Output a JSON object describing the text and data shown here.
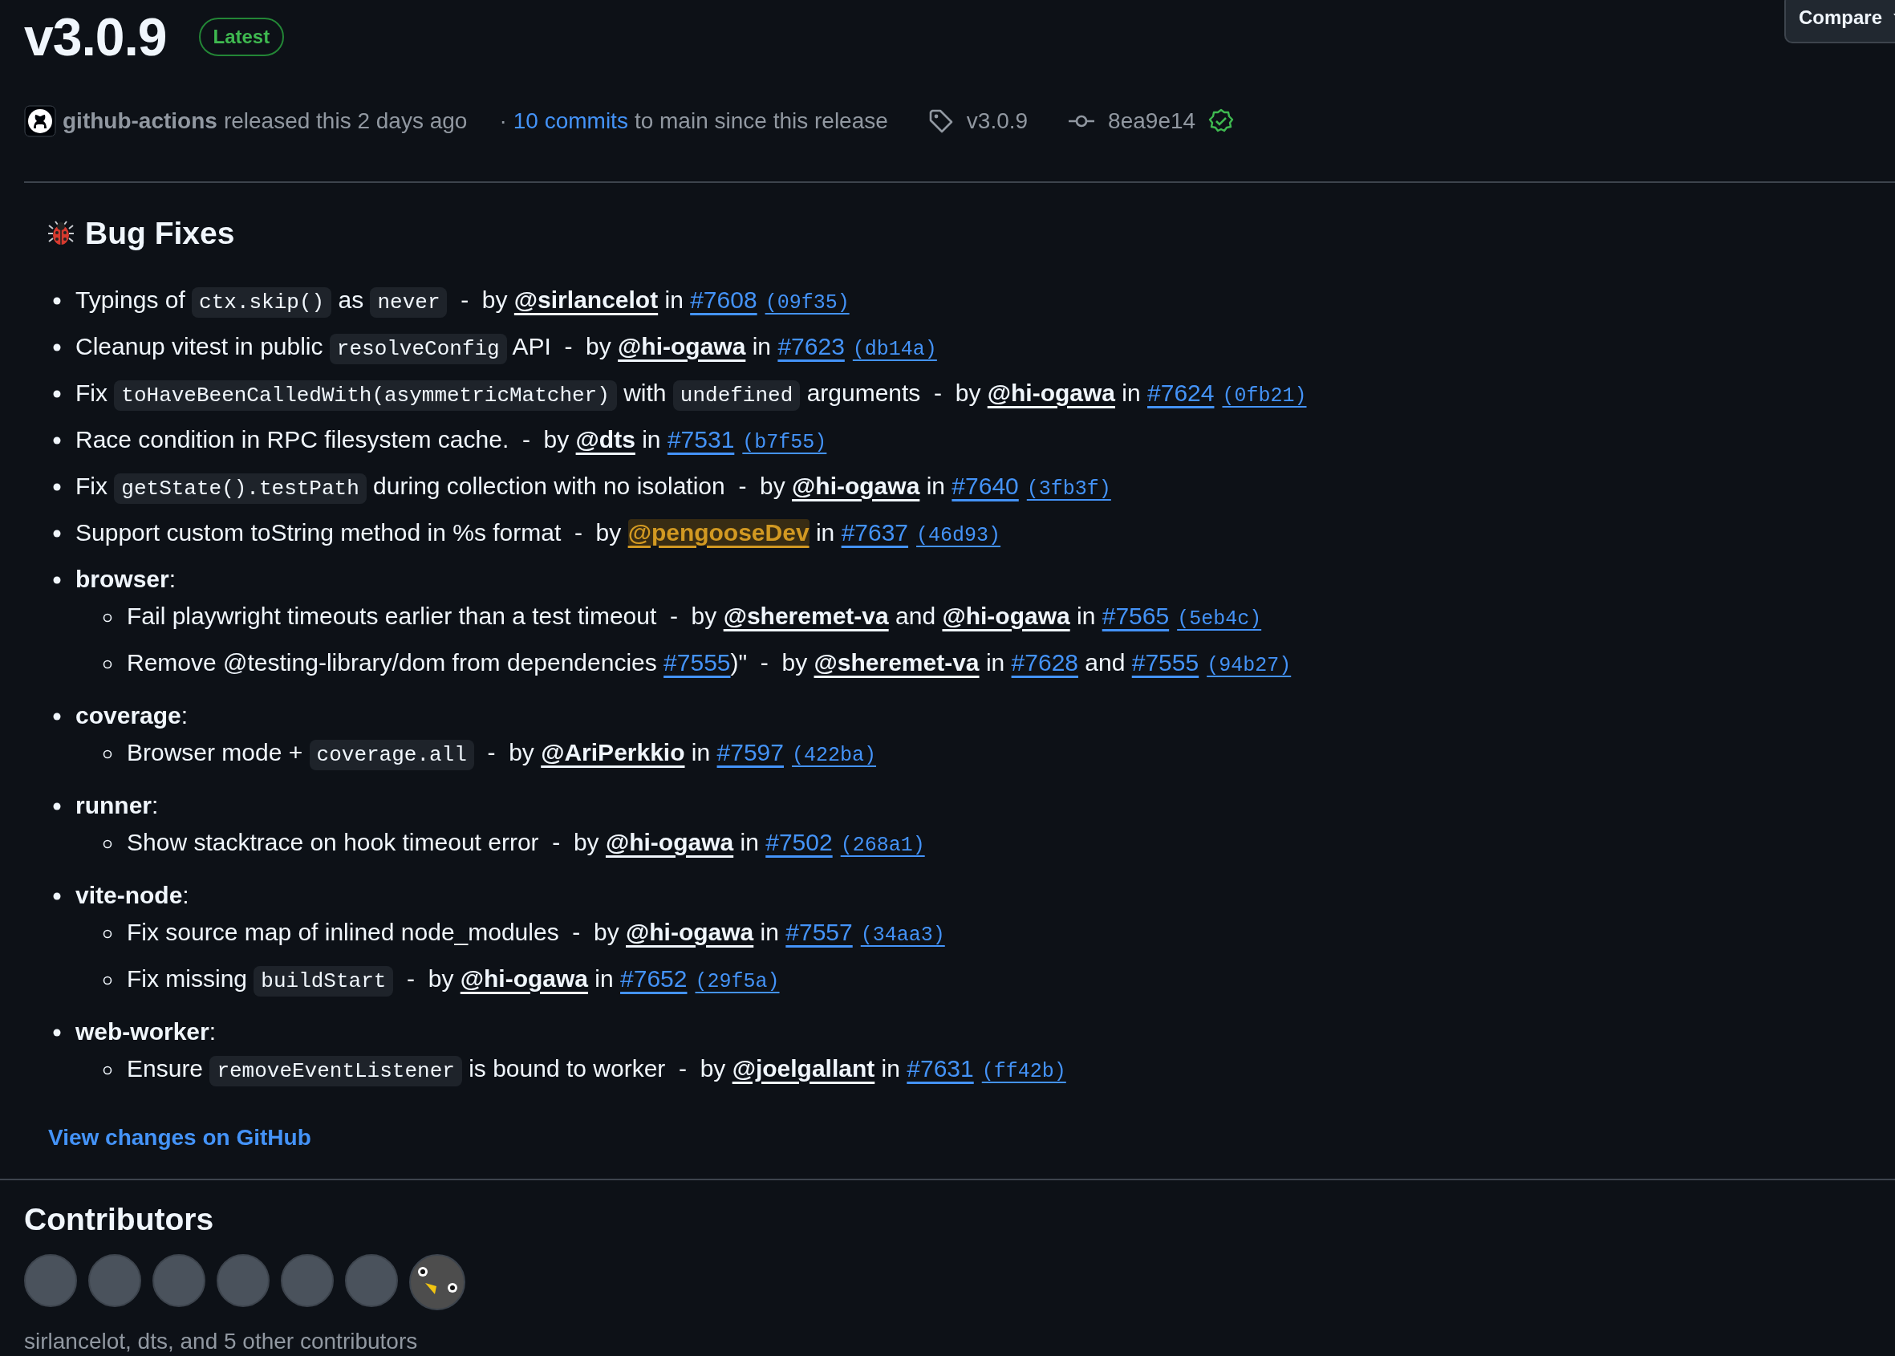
{
  "release": {
    "title": "v3.0.9",
    "badge": "Latest",
    "compare_button": "Compare",
    "author": "github-actions",
    "released_text": "released this 2 days ago",
    "separator": "·",
    "commits_link": "10 commits",
    "commits_text": "to main since this release",
    "tag": "v3.0.9",
    "commit": "8ea9e14",
    "verified": true
  },
  "bug_fixes": {
    "heading": "Bug Fixes",
    "items": [
      {
        "kind": "entry",
        "parts": [
          {
            "kind": "text",
            "text": "Typings of "
          },
          {
            "kind": "code",
            "text": "ctx.skip()"
          },
          {
            "kind": "text",
            "text": " as "
          },
          {
            "kind": "code",
            "text": "never"
          },
          {
            "kind": "text",
            "text": "  -  by "
          },
          {
            "kind": "user",
            "text": "@sirlancelot"
          },
          {
            "kind": "text",
            "text": " in "
          },
          {
            "kind": "issue",
            "text": "#7608"
          },
          {
            "kind": "hash",
            "text": "(09f35)"
          }
        ]
      },
      {
        "kind": "entry",
        "parts": [
          {
            "kind": "text",
            "text": "Cleanup vitest in public "
          },
          {
            "kind": "code",
            "text": "resolveConfig"
          },
          {
            "kind": "text",
            "text": " API  -  by "
          },
          {
            "kind": "user",
            "text": "@hi-ogawa"
          },
          {
            "kind": "text",
            "text": " in "
          },
          {
            "kind": "issue",
            "text": "#7623"
          },
          {
            "kind": "hash",
            "text": "(db14a)"
          }
        ]
      },
      {
        "kind": "entry",
        "parts": [
          {
            "kind": "text",
            "text": "Fix "
          },
          {
            "kind": "code",
            "text": "toHaveBeenCalledWith(asymmetricMatcher)"
          },
          {
            "kind": "text",
            "text": " with "
          },
          {
            "kind": "code",
            "text": "undefined"
          },
          {
            "kind": "text",
            "text": " arguments  -  by "
          },
          {
            "kind": "user",
            "text": "@hi-ogawa"
          },
          {
            "kind": "text",
            "text": " in "
          },
          {
            "kind": "issue",
            "text": "#7624"
          },
          {
            "kind": "hash",
            "text": "(0fb21)"
          }
        ]
      },
      {
        "kind": "entry",
        "parts": [
          {
            "kind": "text",
            "text": "Race condition in RPC filesystem cache.  -  by "
          },
          {
            "kind": "user",
            "text": "@dts"
          },
          {
            "kind": "text",
            "text": " in "
          },
          {
            "kind": "issue",
            "text": "#7531"
          },
          {
            "kind": "hash",
            "text": "(b7f55)"
          }
        ]
      },
      {
        "kind": "entry",
        "parts": [
          {
            "kind": "text",
            "text": "Fix "
          },
          {
            "kind": "code",
            "text": "getState().testPath"
          },
          {
            "kind": "text",
            "text": " during collection with no isolation  -  by "
          },
          {
            "kind": "user",
            "text": "@hi-ogawa"
          },
          {
            "kind": "text",
            "text": " in "
          },
          {
            "kind": "issue",
            "text": "#7640"
          },
          {
            "kind": "hash",
            "text": "(3fb3f)"
          }
        ]
      },
      {
        "kind": "entry",
        "parts": [
          {
            "kind": "text",
            "text": "Support custom toString method in %s format  -  by "
          },
          {
            "kind": "self_user",
            "text": "@pengooseDev"
          },
          {
            "kind": "text",
            "text": " in "
          },
          {
            "kind": "issue",
            "text": "#7637"
          },
          {
            "kind": "hash",
            "text": "(46d93)"
          }
        ]
      },
      {
        "kind": "group",
        "label": "**browser**:",
        "children": [
          {
            "kind": "entry",
            "parts": [
              {
                "kind": "text",
                "text": "Fail playwright timeouts earlier than a test timeout  -  by "
              },
              {
                "kind": "user",
                "text": "@sheremet-va"
              },
              {
                "kind": "text",
                "text": " and "
              },
              {
                "kind": "user",
                "text": "@hi-ogawa"
              },
              {
                "kind": "text",
                "text": " in "
              },
              {
                "kind": "issue",
                "text": "#7565"
              },
              {
                "kind": "hash",
                "text": "(5eb4c)"
              }
            ]
          },
          {
            "kind": "entry",
            "parts": [
              {
                "kind": "text",
                "text": "Remove @testing-library/dom from dependencies "
              },
              {
                "kind": "issue",
                "text": "#7555"
              },
              {
                "kind": "text",
                "text": ")\"  -  by "
              },
              {
                "kind": "user",
                "text": "@sheremet-va"
              },
              {
                "kind": "text",
                "text": " in "
              },
              {
                "kind": "issue",
                "text": "#7628"
              },
              {
                "kind": "text",
                "text": " and "
              },
              {
                "kind": "issue",
                "text": "#7555"
              },
              {
                "kind": "hash",
                "text": "(94b27)"
              }
            ]
          }
        ]
      },
      {
        "kind": "group",
        "label": "**coverage**:",
        "children": [
          {
            "kind": "entry",
            "parts": [
              {
                "kind": "text",
                "text": "Browser mode + "
              },
              {
                "kind": "code",
                "text": "coverage.all"
              },
              {
                "kind": "text",
                "text": "  -  by "
              },
              {
                "kind": "user",
                "text": "@AriPerkkio"
              },
              {
                "kind": "text",
                "text": " in "
              },
              {
                "kind": "issue",
                "text": "#7597"
              },
              {
                "kind": "hash",
                "text": "(422ba)"
              }
            ]
          }
        ]
      },
      {
        "kind": "group",
        "label": "**runner**:",
        "children": [
          {
            "kind": "entry",
            "parts": [
              {
                "kind": "text",
                "text": "Show stacktrace on hook timeout error  -  by "
              },
              {
                "kind": "user",
                "text": "@hi-ogawa"
              },
              {
                "kind": "text",
                "text": " in "
              },
              {
                "kind": "issue",
                "text": "#7502"
              },
              {
                "kind": "hash",
                "text": "(268a1)"
              }
            ]
          }
        ]
      },
      {
        "kind": "group",
        "label": "**vite-node**:",
        "children": [
          {
            "kind": "entry",
            "parts": [
              {
                "kind": "text",
                "text": "Fix source map of inlined node_modules  -  by "
              },
              {
                "kind": "user",
                "text": "@hi-ogawa"
              },
              {
                "kind": "text",
                "text": " in "
              },
              {
                "kind": "issue",
                "text": "#7557"
              },
              {
                "kind": "hash",
                "text": "(34aa3)"
              }
            ]
          },
          {
            "kind": "entry",
            "parts": [
              {
                "kind": "text",
                "text": "Fix missing "
              },
              {
                "kind": "code",
                "text": "buildStart"
              },
              {
                "kind": "text",
                "text": "  -  by "
              },
              {
                "kind": "user",
                "text": "@hi-ogawa"
              },
              {
                "kind": "text",
                "text": " in "
              },
              {
                "kind": "issue",
                "text": "#7652"
              },
              {
                "kind": "hash",
                "text": "(29f5a)"
              }
            ]
          }
        ]
      },
      {
        "kind": "group",
        "label": "**web-worker**:",
        "children": [
          {
            "kind": "entry",
            "parts": [
              {
                "kind": "text",
                "text": "Ensure "
              },
              {
                "kind": "code",
                "text": "removeEventListener"
              },
              {
                "kind": "text",
                "text": " is bound to worker  -  by "
              },
              {
                "kind": "user",
                "text": "@joelgallant"
              },
              {
                "kind": "text",
                "text": " in "
              },
              {
                "kind": "issue",
                "text": "#7631"
              },
              {
                "kind": "hash",
                "text": "(ff42b)"
              }
            ]
          }
        ]
      }
    ]
  },
  "view_changes_link": "View changes on GitHub",
  "contributors": {
    "heading": "Contributors",
    "avatars": [
      {
        "kind": "photo"
      },
      {
        "kind": "photo"
      },
      {
        "kind": "photo"
      },
      {
        "kind": "photo"
      },
      {
        "kind": "photo"
      },
      {
        "kind": "photo"
      },
      {
        "kind": "drawing"
      }
    ],
    "summary": "sirlancelot, dts, and 5 other contributors"
  }
}
